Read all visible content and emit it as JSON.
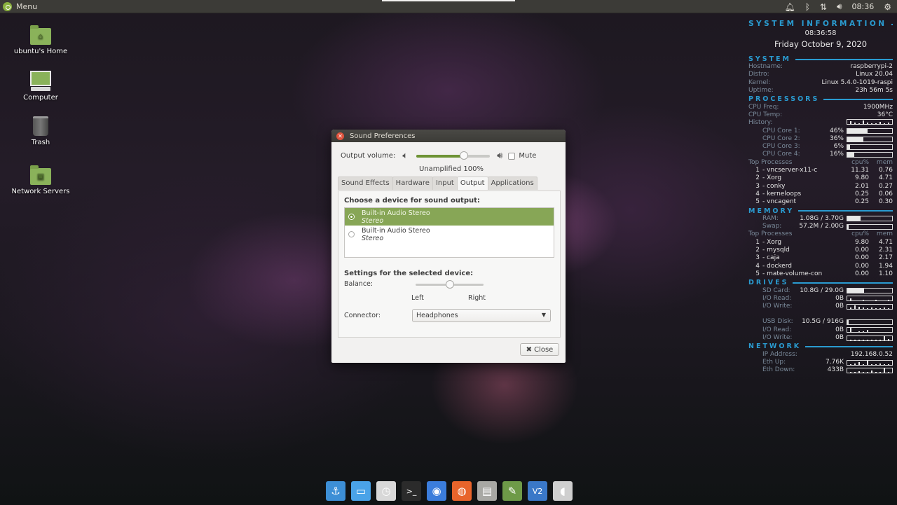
{
  "top_panel": {
    "menu_label": "Menu",
    "clock": "08:36",
    "tray_icons": [
      "notification-bell-icon",
      "bluetooth-icon",
      "network-arrows-icon",
      "volume-icon",
      "settings-gear-icon"
    ]
  },
  "desktop_icons": [
    {
      "label": "ubuntu's Home",
      "icon": "home-folder-icon"
    },
    {
      "label": "Computer",
      "icon": "computer-icon"
    },
    {
      "label": "Trash",
      "icon": "trash-icon"
    },
    {
      "label": "Network Servers",
      "icon": "network-servers-icon"
    }
  ],
  "conky": {
    "title": "SYSTEM INFORMATION",
    "time": "08:36:58",
    "date": "Friday October  9, 2020",
    "system": {
      "header": "SYSTEM",
      "rows": [
        {
          "label": "Hostname:",
          "value": "raspberrypi-2"
        },
        {
          "label": "Distro:",
          "value": "Linux 20.04"
        },
        {
          "label": "Kernel:",
          "value": "Linux 5.4.0-1019-raspi"
        },
        {
          "label": "Uptime:",
          "value": "23h 56m 5s"
        }
      ]
    },
    "processors": {
      "header": "PROCESSORS",
      "freq_label": "CPU Freq:",
      "freq": "1900MHz",
      "temp_label": "CPU Temp:",
      "temp": "36°C",
      "history_label": "History:",
      "cores": [
        {
          "label": "CPU Core 1:",
          "value": "46%",
          "percent": 46
        },
        {
          "label": "CPU Core 2:",
          "value": "36%",
          "percent": 36
        },
        {
          "label": "CPU Core 3:",
          "value": "6%",
          "percent": 6
        },
        {
          "label": "CPU Core 4:",
          "value": "16%",
          "percent": 16
        }
      ],
      "top_header": {
        "label": "Top Processes",
        "cpu": "cpu%",
        "mem": "mem"
      },
      "top": [
        {
          "n": "1",
          "name": "vncserver-x11-c",
          "cpu": "11.31",
          "mem": "0.76"
        },
        {
          "n": "2",
          "name": "Xorg",
          "cpu": "9.80",
          "mem": "4.71"
        },
        {
          "n": "3",
          "name": "conky",
          "cpu": "2.01",
          "mem": "0.27"
        },
        {
          "n": "4",
          "name": "kerneloops",
          "cpu": "0.25",
          "mem": "0.06"
        },
        {
          "n": "5",
          "name": "vncagent",
          "cpu": "0.25",
          "mem": "0.30"
        }
      ]
    },
    "memory": {
      "header": "MEMORY",
      "ram_label": "RAM:",
      "ram": "1.08G / 3.70G",
      "ram_percent": 29,
      "swap_label": "Swap:",
      "swap": "57.2M / 2.00G",
      "swap_percent": 3,
      "top_header": {
        "label": "Top Processes",
        "cpu": "cpu%",
        "mem": "mem"
      },
      "top": [
        {
          "n": "1",
          "name": "Xorg",
          "cpu": "9.80",
          "mem": "4.71"
        },
        {
          "n": "2",
          "name": "mysqld",
          "cpu": "0.00",
          "mem": "2.31"
        },
        {
          "n": "3",
          "name": "caja",
          "cpu": "0.00",
          "mem": "2.17"
        },
        {
          "n": "4",
          "name": "dockerd",
          "cpu": "0.00",
          "mem": "1.94"
        },
        {
          "n": "5",
          "name": "mate-volume-con",
          "cpu": "0.00",
          "mem": "1.10"
        }
      ]
    },
    "drives": {
      "header": "DRIVES",
      "sd_label": "SD Card:",
      "sd": "10.8G / 29.0G",
      "sd_percent": 37,
      "sd_read_label": "I/O Read:",
      "sd_read": "0B",
      "sd_write_label": "I/O Write:",
      "sd_write": "0B",
      "usb_label": "USB Disk:",
      "usb": "10.5G / 916G",
      "usb_percent": 1,
      "usb_read_label": "I/O Read:",
      "usb_read": "0B",
      "usb_write_label": "I/O Write:",
      "usb_write": "0B"
    },
    "network": {
      "header": "NETWORK",
      "ip_label": "IP Address:",
      "ip": "192.168.0.52",
      "up_label": "Eth Up:",
      "up": "7.76K",
      "down_label": "Eth Down:",
      "down": "433B"
    }
  },
  "dialog": {
    "title": "Sound Preferences",
    "output_volume_label": "Output volume:",
    "volume_percent": 65,
    "mute_label": "Mute",
    "mute_checked": false,
    "unamplified_label": "Unamplified",
    "volume_text": "100%",
    "tabs": [
      "Sound Effects",
      "Hardware",
      "Input",
      "Output",
      "Applications"
    ],
    "active_tab": "Output",
    "choose_device_label": "Choose a device for sound output:",
    "devices": [
      {
        "name": "Built-in Audio Stereo",
        "profile": "Stereo",
        "selected": true
      },
      {
        "name": "Built-in Audio Stereo",
        "profile": "Stereo",
        "selected": false
      }
    ],
    "settings_label": "Settings for the selected device:",
    "balance_label": "Balance:",
    "balance_value": 0.5,
    "left_label": "Left",
    "right_label": "Right",
    "connector_label": "Connector:",
    "connector_value": "Headphones",
    "close_label": "Close"
  },
  "dock": [
    {
      "name": "dock-anchor-app",
      "color": "#3d8fd6",
      "glyph": "⚓"
    },
    {
      "name": "dock-show-desktop",
      "color": "#4aa3e8",
      "glyph": "▭"
    },
    {
      "name": "dock-clock-app",
      "color": "#d8d8d8",
      "glyph": "◷"
    },
    {
      "name": "dock-terminal",
      "color": "#2b2b2b",
      "glyph": ">_"
    },
    {
      "name": "dock-chromium",
      "color": "#3b7ddb",
      "glyph": "◉"
    },
    {
      "name": "dock-firefox",
      "color": "#e8642b",
      "glyph": "◍"
    },
    {
      "name": "dock-file-manager",
      "color": "#a8a8a4",
      "glyph": "▤"
    },
    {
      "name": "dock-system-tools",
      "color": "#6e9a48",
      "glyph": "✎"
    },
    {
      "name": "dock-vnc-viewer",
      "color": "#3a78c8",
      "glyph": "V2"
    },
    {
      "name": "dock-mouse-app",
      "color": "#cfcfcf",
      "glyph": "◖"
    }
  ]
}
